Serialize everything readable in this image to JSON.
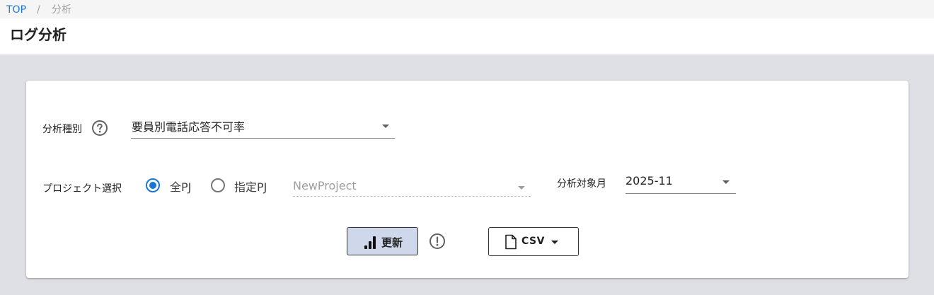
{
  "breadcrumb": {
    "home": "TOP",
    "separator": "/",
    "current": "分析"
  },
  "page": {
    "title": "ログ分析"
  },
  "form": {
    "analysis_type": {
      "label": "分析種別",
      "help_icon": "question-circle-icon",
      "value": "要員別電話応答不可率"
    },
    "project": {
      "label": "プロジェクト選択",
      "options": [
        {
          "label": "全PJ",
          "checked": true
        },
        {
          "label": "指定PJ",
          "checked": false
        }
      ],
      "select_value": "NewProject",
      "select_disabled": true
    },
    "month": {
      "label": "分析対象月",
      "value": "2025-11"
    }
  },
  "actions": {
    "update_label": "更新",
    "update_icon": "bar-chart-icon",
    "info_icon": "exclamation-circle-icon",
    "csv_label": "CSV",
    "csv_icon": "file-icon"
  },
  "colors": {
    "accent": "#1976d2",
    "update_button_bg": "#cfd8ea",
    "background": "#dfe0e5"
  }
}
